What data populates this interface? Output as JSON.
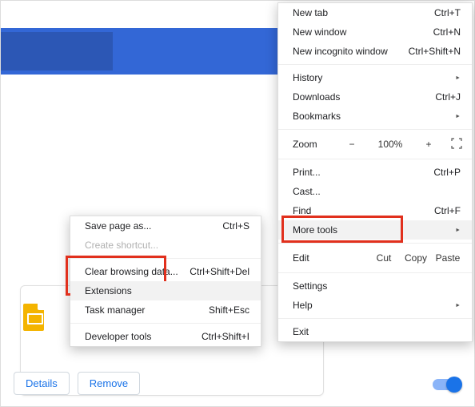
{
  "menu": {
    "new_tab": {
      "label": "New tab",
      "shortcut": "Ctrl+T"
    },
    "new_window": {
      "label": "New window",
      "shortcut": "Ctrl+N"
    },
    "new_incognito": {
      "label": "New incognito window",
      "shortcut": "Ctrl+Shift+N"
    },
    "history": {
      "label": "History"
    },
    "downloads": {
      "label": "Downloads",
      "shortcut": "Ctrl+J"
    },
    "bookmarks": {
      "label": "Bookmarks"
    },
    "zoom": {
      "label": "Zoom",
      "minus": "−",
      "value": "100%",
      "plus": "+"
    },
    "print": {
      "label": "Print...",
      "shortcut": "Ctrl+P"
    },
    "cast": {
      "label": "Cast..."
    },
    "find": {
      "label": "Find",
      "shortcut": "Ctrl+F"
    },
    "more_tools": {
      "label": "More tools"
    },
    "edit": {
      "label": "Edit",
      "cut": "Cut",
      "copy": "Copy",
      "paste": "Paste"
    },
    "settings": {
      "label": "Settings"
    },
    "help": {
      "label": "Help"
    },
    "exit": {
      "label": "Exit"
    }
  },
  "submenu": {
    "save_as": {
      "label": "Save page as...",
      "shortcut": "Ctrl+S"
    },
    "create_shortcut": {
      "label": "Create shortcut..."
    },
    "clear_data": {
      "label": "Clear browsing data...",
      "shortcut": "Ctrl+Shift+Del"
    },
    "extensions": {
      "label": "Extensions"
    },
    "task_manager": {
      "label": "Task manager",
      "shortcut": "Shift+Esc"
    },
    "dev_tools": {
      "label": "Developer tools",
      "shortcut": "Ctrl+Shift+I"
    }
  },
  "card": {
    "details": "Details",
    "remove": "Remove"
  }
}
